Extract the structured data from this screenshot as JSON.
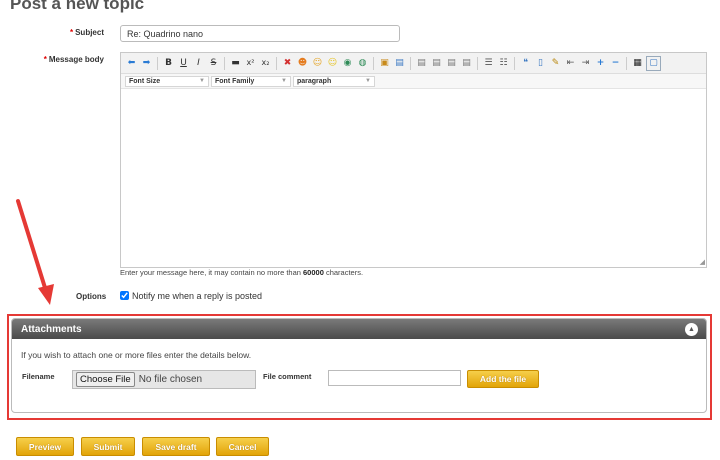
{
  "page": {
    "title": "Post a new topic"
  },
  "form": {
    "subject_label": "Subject",
    "subject_value": "Re: Quadrino nano",
    "message_label": "Message body",
    "editor": {
      "toolbar": {
        "bold": "B",
        "underline": "U",
        "italic": "I",
        "strike": "S",
        "superscript": "x²",
        "subscript": "x₂"
      },
      "font_size_label": "Font Size",
      "font_family_label": "Font Family",
      "format_label": "paragraph"
    },
    "hint_prefix": "Enter your message here, it may contain no more than ",
    "hint_limit": "60000",
    "hint_suffix": " characters.",
    "options_label": "Options",
    "notify_label": "Notify me when a reply is posted"
  },
  "attachments": {
    "title": "Attachments",
    "intro": "If you wish to attach one or more files enter the details below.",
    "filename_label": "Filename",
    "choose_file_label": "Choose File",
    "no_file_text": "No file chosen",
    "comment_label": "File comment",
    "add_file_label": "Add the file"
  },
  "actions": {
    "preview": "Preview",
    "submit": "Submit",
    "save_draft": "Save draft",
    "cancel": "Cancel"
  },
  "colors": {
    "annotation_red": "#e53935",
    "button_gold": "#f0b820",
    "header_dark": "#5a5a5a"
  }
}
